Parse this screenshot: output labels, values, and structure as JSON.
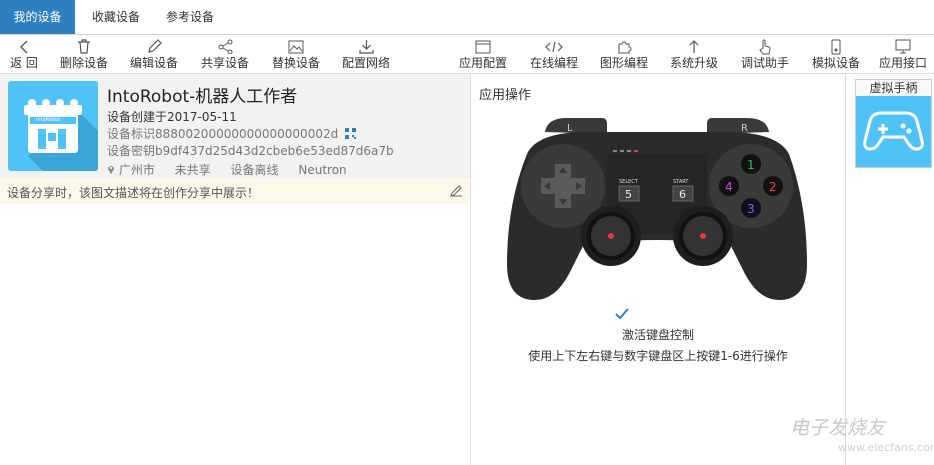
{
  "tabs": [
    {
      "label": "我的设备",
      "active": true
    },
    {
      "label": "收藏设备",
      "active": false
    },
    {
      "label": "参考设备",
      "active": false
    }
  ],
  "toolbar": {
    "back": "返 回",
    "delete": "删除设备",
    "edit": "编辑设备",
    "share": "共享设备",
    "replace": "替换设备",
    "network": "配置网络",
    "app_config": "应用配置",
    "online_code": "在线编程",
    "graphic_code": "图形编程",
    "upgrade": "系统升级",
    "debug": "调试助手",
    "simulate": "模拟设备",
    "app_api": "应用接口"
  },
  "device": {
    "title": "IntoRobot-机器人工作者",
    "created": "设备创建于2017-05-11",
    "id": "设备标识88800200000000000000002d",
    "key": "设备密钥b9df437d25d43d2cbeb6e53ed87d6a7b",
    "location": "广州市",
    "share_status": "未共享",
    "online_status": "设备离线",
    "platform": "Neutron",
    "icon_text": "IntoRobot"
  },
  "share_hint": "设备分享时，该图文描述将在创作分享中展示！",
  "app": {
    "title": "应用操作",
    "activate_label": "激活键盘控制",
    "instruction": "使用上下左右键与数字键盘区上按键1-6进行操作",
    "controller": {
      "l": "L",
      "r": "R",
      "select": "SELECT",
      "start": "START",
      "btn5": "5",
      "btn6": "6",
      "btn1": "1",
      "btn2": "2",
      "btn3": "3",
      "btn4": "4"
    }
  },
  "virtual_pad": {
    "label": "虚拟手柄"
  },
  "watermark": {
    "brand": "电子发烧友",
    "url": "www.elecfans.com"
  },
  "colors": {
    "accent": "#2e7fbf",
    "tile": "#4fc3f7",
    "btn1": "#22c55e",
    "btn2": "#ef4444",
    "btn3": "#8b5cf6",
    "btn4": "#d946ef"
  }
}
